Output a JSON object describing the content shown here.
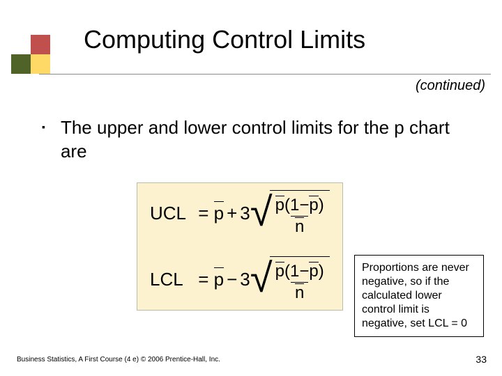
{
  "title": "Computing Control Limits",
  "continued_label": "(continued)",
  "bullet": "The upper and lower control limits for the p chart are",
  "formulas": {
    "ucl": {
      "label": "UCL",
      "sign": "+",
      "coef": "3",
      "pvar": "p",
      "one": "1",
      "nvar": "n"
    },
    "lcl": {
      "label": "LCL",
      "sign": "−",
      "coef": "3",
      "pvar": "p",
      "one": "1",
      "nvar": "n"
    }
  },
  "note": "Proportions are never negative, so if the calculated lower control limit is negative, set LCL = 0",
  "footer": "Business Statistics, A First Course (4 e) © 2006 Prentice-Hall, Inc.",
  "page_number": "33"
}
